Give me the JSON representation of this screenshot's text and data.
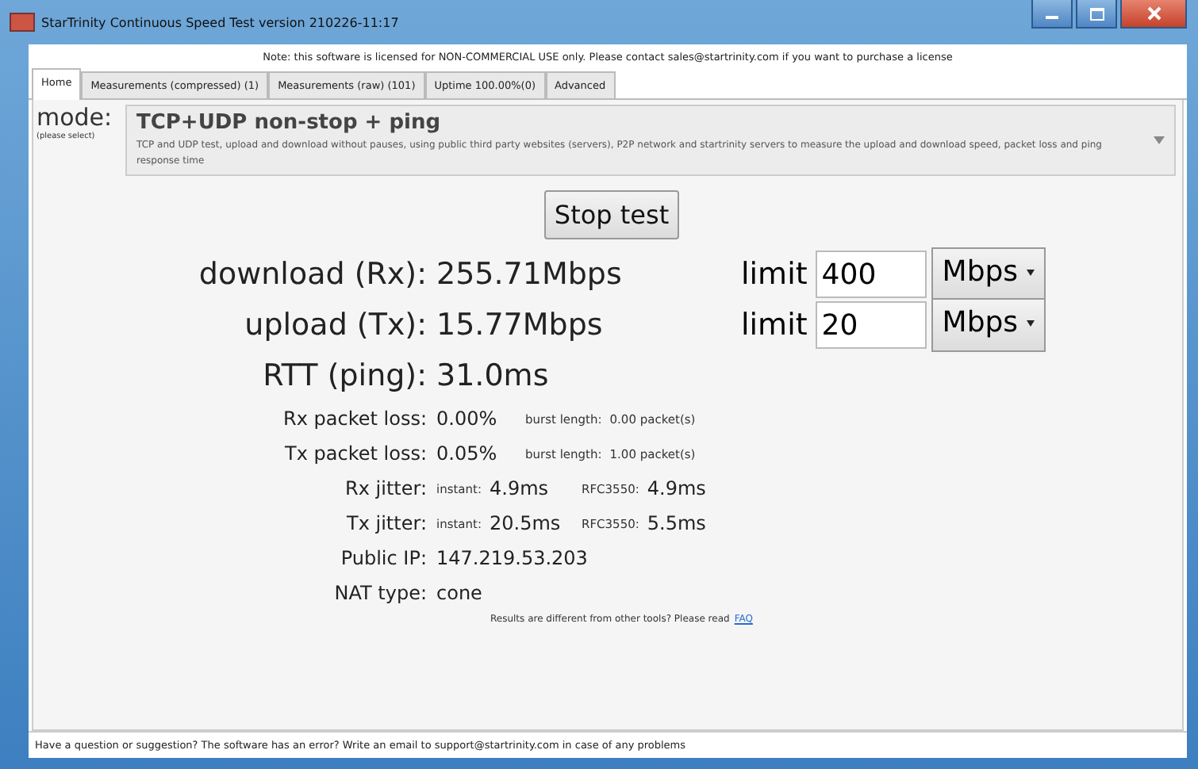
{
  "window": {
    "title": "StarTrinity Continuous Speed Test version 210226-11:17"
  },
  "notice": "Note: this software is licensed for NON-COMMERCIAL USE only. Please contact sales@startrinity.com if you want to purchase a license",
  "tabs": [
    {
      "label": "Home",
      "selected": true
    },
    {
      "label": "Measurements (compressed) (1)",
      "selected": false
    },
    {
      "label": "Measurements (raw) (101)",
      "selected": false
    },
    {
      "label": "Uptime 100.00%(0)",
      "selected": false
    },
    {
      "label": "Advanced",
      "selected": false
    }
  ],
  "mode": {
    "label": "mode:",
    "hint": "(please select)",
    "title": "TCP+UDP non-stop + ping",
    "description": "TCP and UDP test, upload and download without pauses, using public third party websites (servers), P2P network and startrinity servers to measure the upload and download speed, packet loss and ping response time"
  },
  "stop_button": "Stop test",
  "speeds": [
    {
      "label": "download (Rx):",
      "value": "255.71Mbps",
      "limit_label": "limit",
      "limit_value": "400",
      "unit": "Mbps"
    },
    {
      "label": "upload (Tx):",
      "value": "15.77Mbps",
      "limit_label": "limit",
      "limit_value": "20",
      "unit": "Mbps"
    }
  ],
  "rtt": {
    "label": "RTT (ping):",
    "value": "31.0ms"
  },
  "packet_loss": [
    {
      "label": "Rx packet loss:",
      "value": "0.00%",
      "burst_label": "burst length:",
      "burst_value": "0.00 packet(s)"
    },
    {
      "label": "Tx packet loss:",
      "value": "0.05%",
      "burst_label": "burst length:",
      "burst_value": "1.00 packet(s)"
    }
  ],
  "jitter": [
    {
      "label": "Rx jitter:",
      "instant_label": "instant:",
      "instant_value": "4.9ms",
      "rfc_label": "RFC3550:",
      "rfc_value": "4.9ms"
    },
    {
      "label": "Tx jitter:",
      "instant_label": "instant:",
      "instant_value": "20.5ms",
      "rfc_label": "RFC3550:",
      "rfc_value": "5.5ms"
    }
  ],
  "info": [
    {
      "label": "Public IP:",
      "value": "147.219.53.203"
    },
    {
      "label": "NAT type:",
      "value": "cone"
    }
  ],
  "faq": {
    "text": "Results are different from other tools? Please read",
    "link": "FAQ"
  },
  "status_bar": "Have a question or suggestion? The software has an error? Write an email to support@startrinity.com in case of any problems"
}
